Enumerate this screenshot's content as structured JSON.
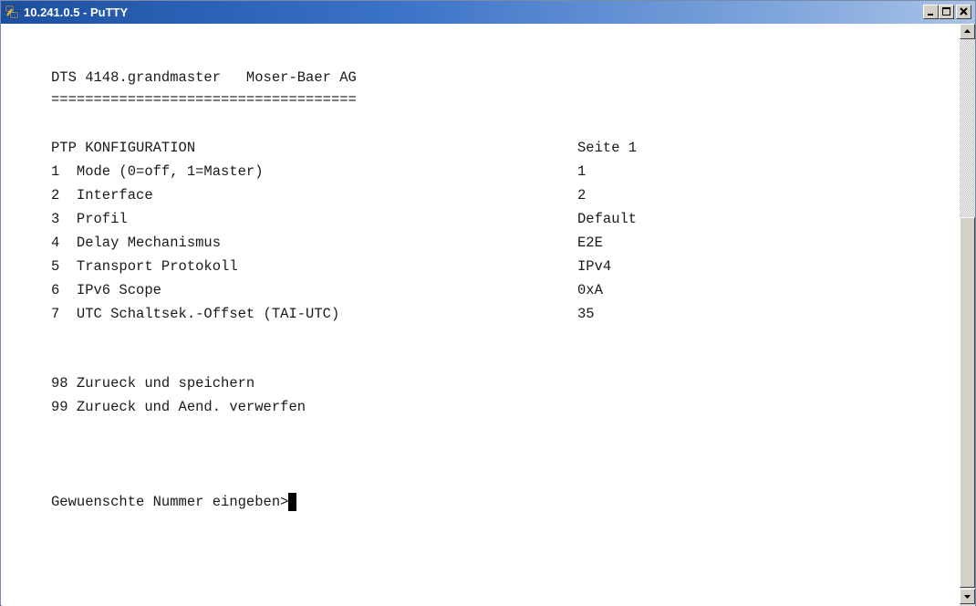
{
  "window": {
    "title": "10.241.0.5 - PuTTY"
  },
  "terminal": {
    "header": "DTS 4148.grandmaster   Moser-Baer AG",
    "separator": "====================================",
    "section_title": "PTP KONFIGURATION",
    "page_label": "Seite 1",
    "menu_items": [
      {
        "label": "1  Mode (0=off, 1=Master)",
        "value": "1"
      },
      {
        "label": "2  Interface",
        "value": "2"
      },
      {
        "label": "3  Profil",
        "value": "Default"
      },
      {
        "label": "4  Delay Mechanismus",
        "value": "E2E"
      },
      {
        "label": "5  Transport Protokoll",
        "value": "IPv4"
      },
      {
        "label": "6  IPv6 Scope",
        "value": "0xA"
      },
      {
        "label": "7  UTC Schaltsek.-Offset (TAI-UTC)",
        "value": "35"
      }
    ],
    "actions": [
      {
        "label": "98 Zurueck und speichern"
      },
      {
        "label": "99 Zurueck und Aend. verwerfen"
      }
    ],
    "prompt": "Gewuenschte Nummer eingeben>"
  },
  "colors": {
    "title_bar": "#1c4fa0",
    "terminal_bg": "#ffffff",
    "terminal_fg": "#1a1a1a"
  },
  "icons": {
    "app": "putty-icon",
    "minimize": "minimize-icon",
    "maximize": "maximize-icon",
    "close": "close-icon",
    "scroll_up": "arrow-up-icon",
    "scroll_down": "arrow-down-icon"
  }
}
